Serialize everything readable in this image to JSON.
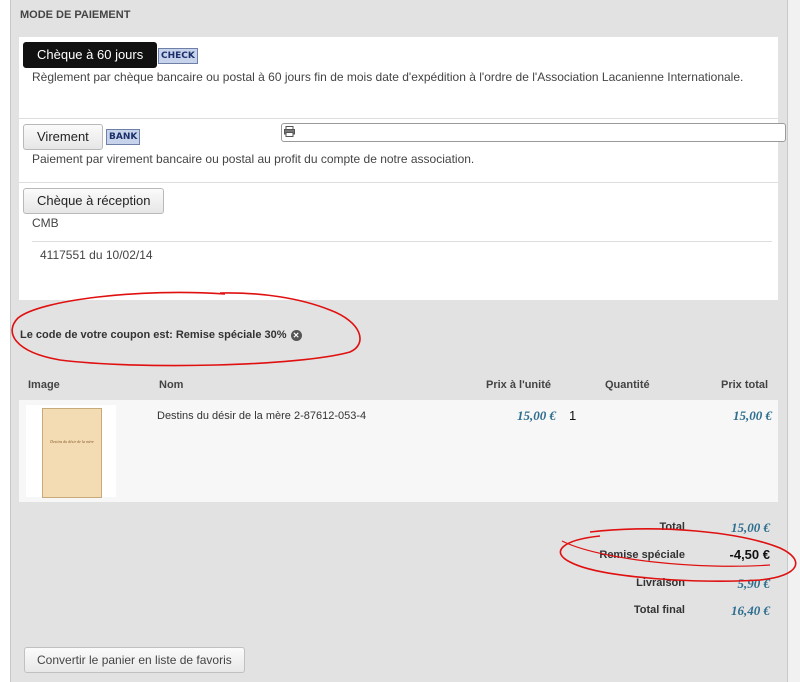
{
  "section_title": "MODE DE PAIEMENT",
  "payment_methods": [
    {
      "label": "Chèque à 60 jours",
      "logo": "CHECK",
      "description": "Règlement par chèque bancaire ou postal à 60 jours fin de mois date d'expédition à  l'ordre de l'Association Lacanienne Internationale."
    },
    {
      "label": "Virement",
      "logo": "BANK",
      "description": "Paiement par virement bancaire ou postal au profit du compte de notre association."
    },
    {
      "label": "Chèque à réception",
      "extra_1": "CMB",
      "extra_2": "4117551 du 10/02/14"
    }
  ],
  "coupon_text": "Le code de votre coupon est: Remise spéciale 30%",
  "table_headers": {
    "image": "Image",
    "name": "Nom",
    "unit_price": "Prix à l'unité",
    "quantity": "Quantité",
    "total_price": "Prix total"
  },
  "items": [
    {
      "name": "Destins du désir de la mère 2-87612-053-4",
      "unit_price": "15,00 €",
      "quantity": "1",
      "total": "15,00 €",
      "cover_title": "Destins du désir de la mère"
    }
  ],
  "summary": {
    "total_label": "Total",
    "total_value": "15,00 €",
    "discount_label": "Remise spéciale",
    "discount_value": "-4,50 €",
    "shipping_label": "Livraison",
    "shipping_value": "5,90 €",
    "final_label": "Total final",
    "final_value": "16,40 €"
  },
  "favorites_button": "Convertir le panier en liste de favoris",
  "colors": {
    "price": "#2e6e8e",
    "annotation": "#e01010",
    "active_button": "#111111"
  }
}
